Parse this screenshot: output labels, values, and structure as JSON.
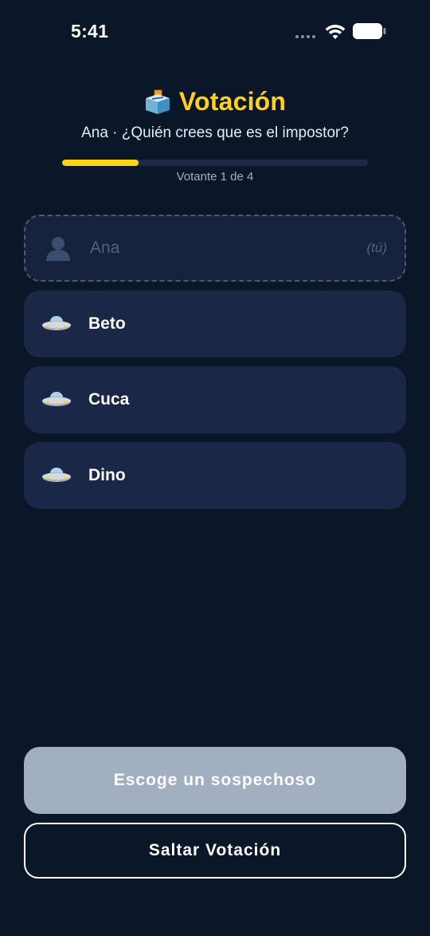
{
  "status_bar": {
    "time": "5:41"
  },
  "header": {
    "icon": "ballot-box-icon",
    "title": "Votación",
    "subtitle": "Ana · ¿Quién crees que es el impostor?"
  },
  "progress": {
    "label": "Votante 1 de 4",
    "current": 1,
    "total": 4,
    "fraction": 0.25
  },
  "players": [
    {
      "name": "Ana",
      "icon": "person-silhouette-icon",
      "tag": "(tú)",
      "is_self": true
    },
    {
      "name": "Beto",
      "icon": "ufo-icon",
      "is_self": false
    },
    {
      "name": "Cuca",
      "icon": "ufo-icon",
      "is_self": false
    },
    {
      "name": "Dino",
      "icon": "ufo-icon",
      "is_self": false
    }
  ],
  "actions": {
    "choose_label": "Escoge un sospechoso",
    "skip_label": "Saltar Votación"
  },
  "colors": {
    "background": "#0b1628",
    "accent": "#ffd21a",
    "card": "#1a2747",
    "disabled_button": "#a2afc1"
  }
}
